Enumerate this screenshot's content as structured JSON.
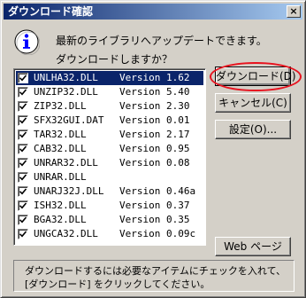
{
  "window": {
    "title": "ダウンロード確認",
    "close_glyph": "×"
  },
  "message": {
    "line1": "最新のライブラリへアップデートできます。",
    "line2": "ダウンロードしますか？"
  },
  "files": [
    {
      "name": "UNLHA32.DLL",
      "version": "Version 1.62",
      "checked": true,
      "selected": true
    },
    {
      "name": "UNZIP32.DLL",
      "version": "Version 5.40",
      "checked": true,
      "selected": false
    },
    {
      "name": "ZIP32.DLL",
      "version": "Version 2.30",
      "checked": true,
      "selected": false
    },
    {
      "name": "SFX32GUI.DAT",
      "version": "Version 0.01",
      "checked": true,
      "selected": false
    },
    {
      "name": "TAR32.DLL",
      "version": "Version 2.17",
      "checked": true,
      "selected": false
    },
    {
      "name": "CAB32.DLL",
      "version": "Version 0.95",
      "checked": true,
      "selected": false
    },
    {
      "name": "UNRAR32.DLL",
      "version": "Version 0.08",
      "checked": true,
      "selected": false
    },
    {
      "name": "UNRAR.DLL",
      "version": "",
      "checked": true,
      "selected": false
    },
    {
      "name": "UNARJ32J.DLL",
      "version": "Version 0.46a",
      "checked": true,
      "selected": false
    },
    {
      "name": "ISH32.DLL",
      "version": "Version 0.37",
      "checked": true,
      "selected": false
    },
    {
      "name": "BGA32.DLL",
      "version": "Version 0.35",
      "checked": true,
      "selected": false
    },
    {
      "name": "UNGCA32.DLL",
      "version": "Version 0.09c",
      "checked": true,
      "selected": false
    }
  ],
  "buttons": {
    "download": "ダウンロード(D)",
    "cancel": "キャンセル(C)",
    "settings": "設定(O)...",
    "webpage": "Web ページ"
  },
  "status": {
    "line1": "ダウンロードするには必要なアイテムにチェックを入れて、",
    "line2": "[ダウンロード] をクリックしてください。"
  },
  "colors": {
    "titlebar_start": "#0a246a",
    "titlebar_end": "#a6caf0",
    "selection": "#0a246a",
    "annotation_red": "#e8131f"
  }
}
